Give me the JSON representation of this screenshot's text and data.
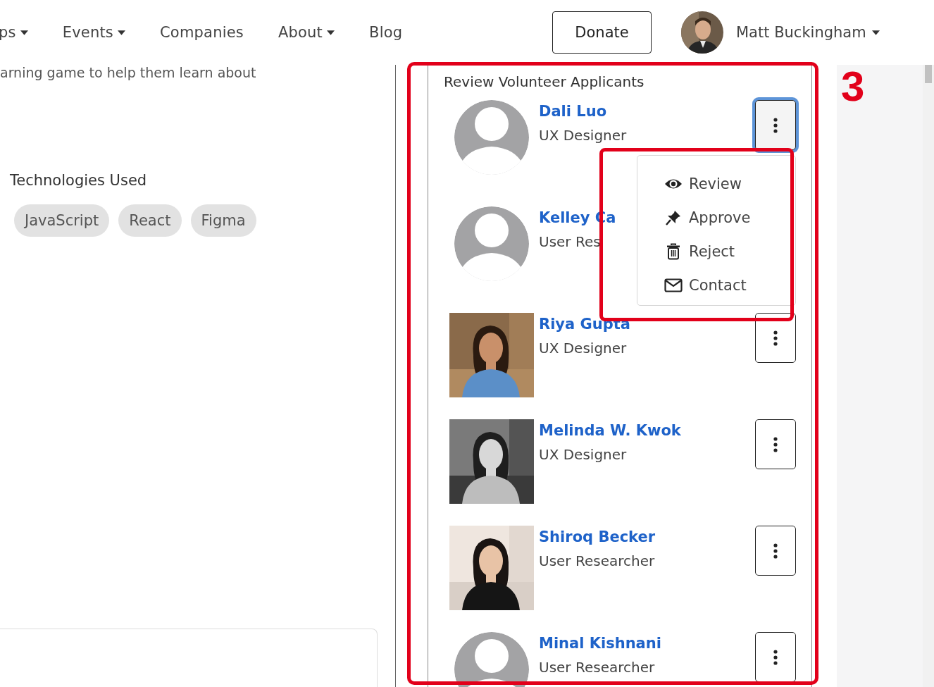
{
  "nav": {
    "items": [
      {
        "label": "ps",
        "caret": true
      },
      {
        "label": "Events",
        "caret": true
      },
      {
        "label": "Companies",
        "caret": false
      },
      {
        "label": "About",
        "caret": true
      },
      {
        "label": "Blog",
        "caret": false
      }
    ],
    "donate": "Donate",
    "user": "Matt Buckingham"
  },
  "left": {
    "intro_fragment": "arning game to help them learn about",
    "technologies_title": "Technologies Used",
    "technologies": [
      "JavaScript",
      "React",
      "Figma"
    ]
  },
  "panel": {
    "title": "Review Volunteer Applicants",
    "applicants": [
      {
        "name": "Dali Luo",
        "role": "UX Designer",
        "photo": false,
        "menu_open": true
      },
      {
        "name": "Kelley Ca",
        "role": "User Res",
        "photo": false,
        "menu_open": false
      },
      {
        "name": "Riya Gupta",
        "role": "UX Designer",
        "photo": true,
        "menu_open": false
      },
      {
        "name": "Melinda W. Kwok",
        "role": "UX Designer",
        "photo": true,
        "menu_open": false
      },
      {
        "name": "Shiroq Becker",
        "role": "User Researcher",
        "photo": true,
        "menu_open": false
      },
      {
        "name": "Minal Kishnani",
        "role": "User Researcher",
        "photo": false,
        "menu_open": false
      }
    ]
  },
  "menu": [
    {
      "kind": "review",
      "label": "Review"
    },
    {
      "kind": "approve",
      "label": "Approve"
    },
    {
      "kind": "reject",
      "label": "Reject"
    },
    {
      "kind": "contact",
      "label": "Contact"
    }
  ],
  "annotation": {
    "label": "3"
  }
}
